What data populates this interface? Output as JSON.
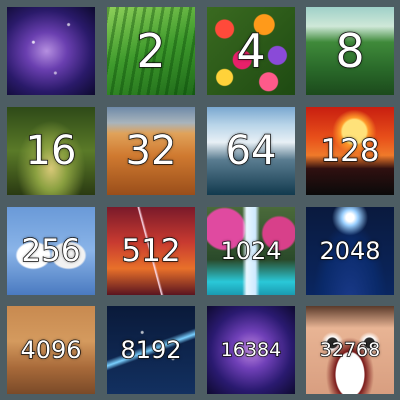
{
  "game": {
    "title": ""
  },
  "tiles": [
    {
      "value": "",
      "image": "galaxy"
    },
    {
      "value": "2",
      "image": "grass"
    },
    {
      "value": "4",
      "image": "flowers"
    },
    {
      "value": "8",
      "image": "hedge-maze"
    },
    {
      "value": "16",
      "image": "forest-path"
    },
    {
      "value": "32",
      "image": "desert-dunes"
    },
    {
      "value": "64",
      "image": "glacier"
    },
    {
      "value": "128",
      "image": "sunset"
    },
    {
      "value": "256",
      "image": "swans"
    },
    {
      "value": "512",
      "image": "lightning-storm"
    },
    {
      "value": "1024",
      "image": "waterfall"
    },
    {
      "value": "2048",
      "image": "earth-from-space"
    },
    {
      "value": "4096",
      "image": "mars-surface"
    },
    {
      "value": "8192",
      "image": "comet"
    },
    {
      "value": "16384",
      "image": "nebula"
    },
    {
      "value": "32768",
      "image": "smiling-face"
    }
  ],
  "colors": {
    "board_background": "#4d5d63",
    "number_text": "#ffffff",
    "number_outline": "#111111"
  }
}
